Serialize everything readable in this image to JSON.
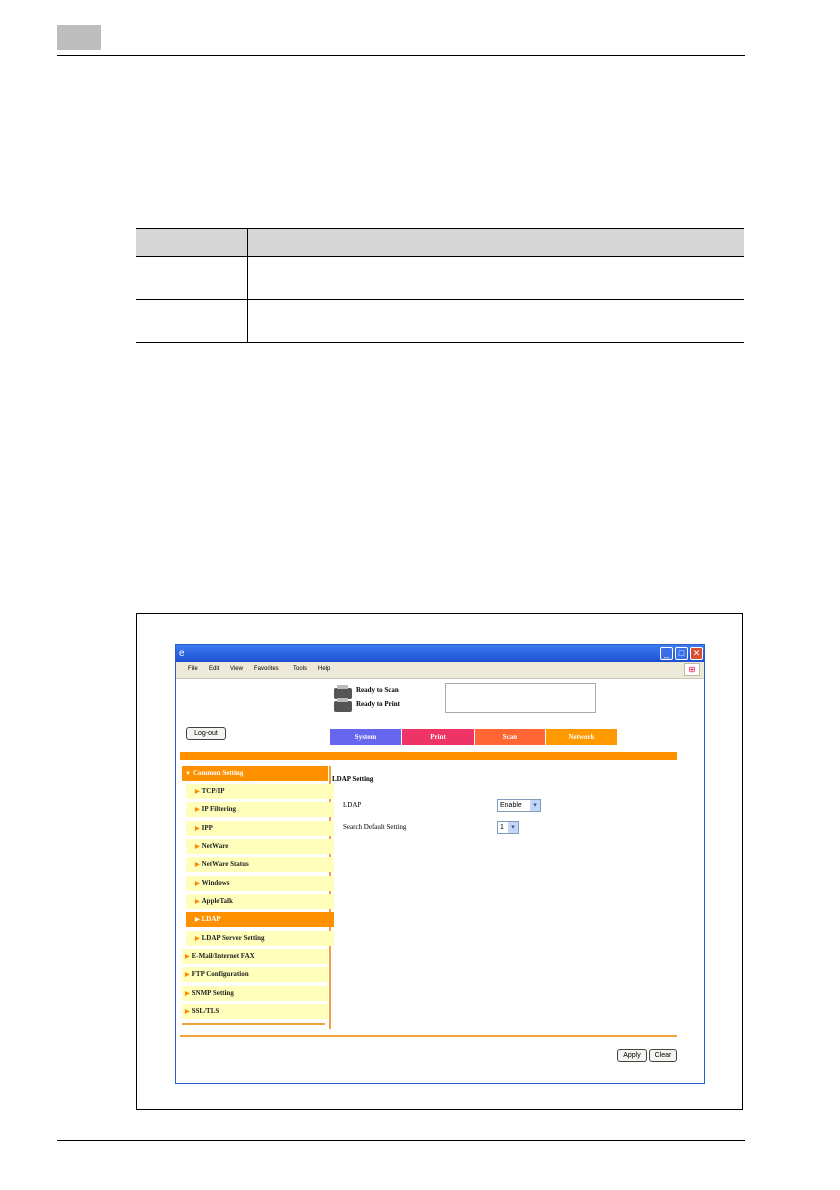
{
  "table": {
    "rows": [
      [
        "",
        ""
      ],
      [
        "",
        ""
      ]
    ]
  },
  "browser": {
    "menu": [
      "File",
      "Edit",
      "View",
      "Favorites",
      "Tools",
      "Help"
    ],
    "status": {
      "scan": "Ready to Scan",
      "print": "Ready to Print"
    },
    "logout_label": "Log-out",
    "tabs": [
      {
        "label": "System",
        "color": "#6666ee"
      },
      {
        "label": "Print",
        "color": "#ee3366"
      },
      {
        "label": "Scan",
        "color": "#ff6633"
      },
      {
        "label": "Network",
        "color": "#ff9900"
      }
    ],
    "sidebar": {
      "items": [
        {
          "label": "Common Setting"
        },
        {
          "label": "TCP/IP"
        },
        {
          "label": "IP Filtering"
        },
        {
          "label": "IPP"
        },
        {
          "label": "NetWare"
        },
        {
          "label": "NetWare Status"
        },
        {
          "label": "Windows"
        },
        {
          "label": "AppleTalk"
        },
        {
          "label": "LDAP"
        },
        {
          "label": "LDAP Server Setting"
        },
        {
          "label": "E-Mail/Internet FAX"
        },
        {
          "label": "FTP Configuration"
        },
        {
          "label": "SNMP Setting"
        },
        {
          "label": "SSL/TLS"
        }
      ]
    },
    "content": {
      "title": "LDAP Setting",
      "fields": [
        {
          "label": "LDAP",
          "value": "Enable"
        },
        {
          "label": "Search Default Setting",
          "value": "1"
        }
      ]
    },
    "buttons": {
      "apply": "Apply",
      "clear": "Clear"
    }
  }
}
